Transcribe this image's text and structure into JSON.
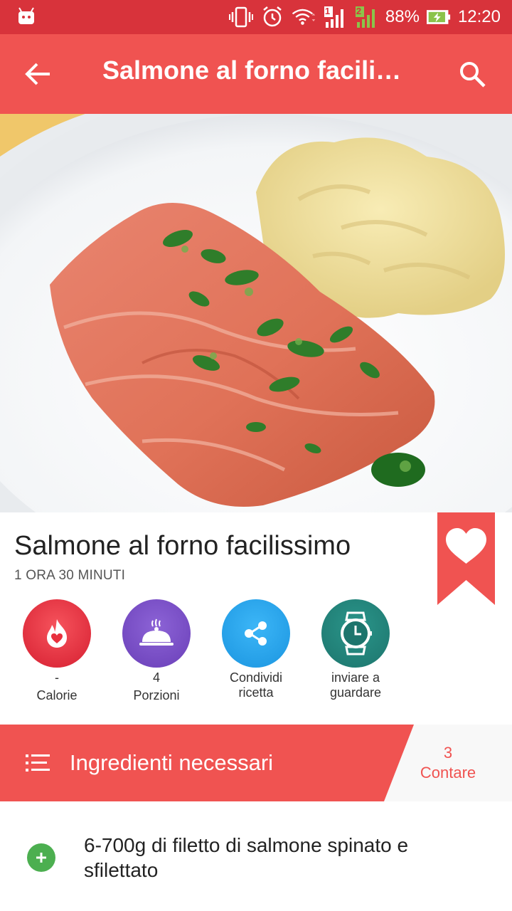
{
  "status_bar": {
    "battery_percent": "88%",
    "time": "12:20",
    "sim1_label": "1",
    "sim2_label": "2",
    "icons": [
      "android-icon",
      "vibrate-icon",
      "alarm-icon",
      "wifi-icon",
      "signal-icon",
      "signal-icon",
      "battery-charging-icon"
    ]
  },
  "toolbar": {
    "title": "Salmone al forno facilissimo",
    "back_icon": "arrow-back-icon",
    "search_icon": "search-icon"
  },
  "recipe": {
    "title": "Salmone al forno facilissimo",
    "time": "1 ORA 30 MINUTI",
    "favorite_icon": "heart-icon"
  },
  "actions": [
    {
      "icon": "calories-flame-icon",
      "value": "-",
      "label": "Calorie",
      "color": "#e8303d"
    },
    {
      "icon": "serving-dish-icon",
      "value": "4",
      "label": "Porzioni",
      "color": "#7b4fc8"
    },
    {
      "icon": "share-icon",
      "value": "Condividi",
      "label": "ricetta",
      "color": "#26a6f0"
    },
    {
      "icon": "watch-icon",
      "value": "inviare a",
      "label": "guardare",
      "color": "#23837a"
    }
  ],
  "ingredients": {
    "header_title": "Ingredienti necessari",
    "count": "3",
    "count_label": "Contare",
    "items": [
      {
        "text": "6-700g di filetto di salmone spinato e sfilettato"
      }
    ]
  },
  "colors": {
    "status_bar": "#d8333b",
    "toolbar": "#f05351",
    "accent": "#f05351",
    "add_button": "#4caf50"
  }
}
